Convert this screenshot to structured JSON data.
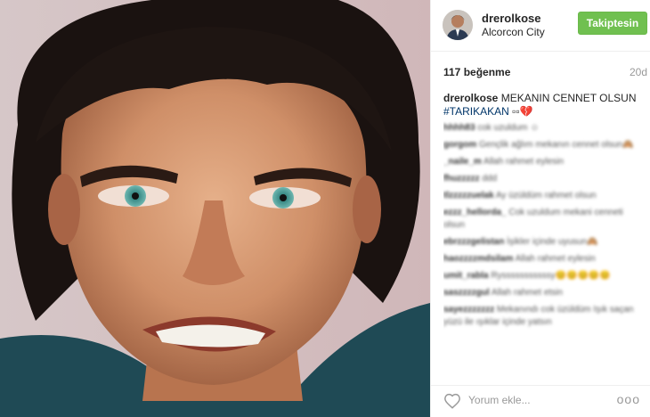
{
  "post": {
    "username": "drerolkose",
    "location": "Alcorcon City",
    "follow_label": "Takiptesin",
    "likes": "117 beğenme",
    "time": "20d",
    "caption_user": "drerolkose",
    "caption_text": " MEKANIN CENNET OLSUN",
    "caption_tag": "#TARIKAKAN",
    "caption_tail": " ▫▫💔",
    "comment_placeholder": "Yorum ekle...",
    "more_label": "ooo"
  },
  "comments": [
    {
      "user": "hhhh83",
      "text": "cok uzuldum ☺"
    },
    {
      "user": "gorgom",
      "text": "Gençlik ağlım mekanın cennet olsun🙈"
    },
    {
      "user": "_naile_m",
      "text": "Allah rahmet eylesin"
    },
    {
      "user": "fhuzzzzz",
      "text": "ddd"
    },
    {
      "user": "tlzzzzzuelak",
      "text": "Ay üzüldüm rahmet olsun"
    },
    {
      "user": "ezzz_hellorda_",
      "text": "Cok uzuldum mekani cenneti olsun"
    },
    {
      "user": "ebrzzzgelistan",
      "text": "İşikler içinde uyusun🙈"
    },
    {
      "user": "haozzzzmdsilam",
      "text": "Allah rahmet eylesin"
    },
    {
      "user": "umit_rabla",
      "text": "Rysssssssssssy😊😊😊😊😊"
    },
    {
      "user": "saszzzzgul",
      "text": "Allah rahmet etsin"
    },
    {
      "user": "sayezzzzzzz",
      "text": "Mekanındı cok üzüldüm Işık saçan yüzü ile ışıklar içinde yatsın"
    }
  ],
  "colors": {
    "follow_bg": "#70c050",
    "hashtag": "#003569"
  },
  "icons": {
    "heart": "heart-outline-icon",
    "avatar": "avatar"
  }
}
